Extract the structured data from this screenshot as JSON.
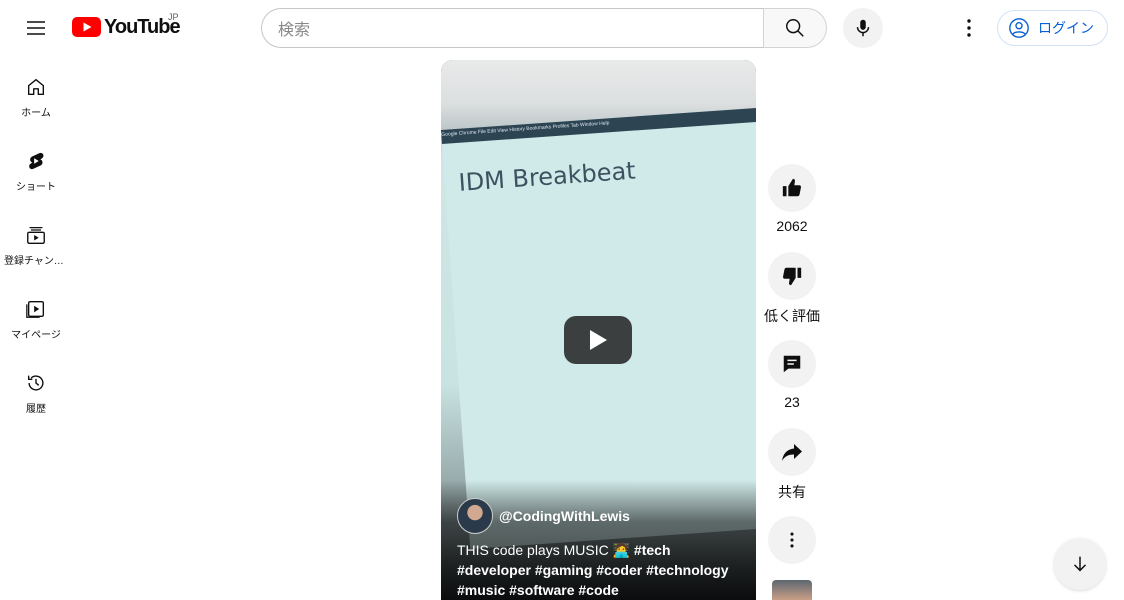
{
  "header": {
    "logo_text": "YouTube",
    "region": "JP",
    "search_placeholder": "検索",
    "login_label": "ログイン"
  },
  "sidebar": {
    "items": [
      {
        "label": "ホーム",
        "icon": "home-icon"
      },
      {
        "label": "ショート",
        "icon": "shorts-icon"
      },
      {
        "label": "登録チャンネル",
        "icon": "subscriptions-icon"
      },
      {
        "label": "マイページ",
        "icon": "library-icon"
      },
      {
        "label": "履歴",
        "icon": "history-icon"
      }
    ]
  },
  "video": {
    "screen_tabs": "Google Chrome   File   Edit   View   History   Bookmarks   Profiles   Tab   Window   Help",
    "code_heading": "IDM Breakbeat",
    "channel": "@CodingWithLewis",
    "title_plain": "THIS code plays MUSIC 🧑‍💻",
    "hashtags": "#tech #developer #gaming #coder #technology #music #software #code"
  },
  "actions": {
    "like_count": "2062",
    "dislike_label": "低く評価",
    "comment_count": "23",
    "share_label": "共有"
  },
  "colors": {
    "brand_red": "#ff0000",
    "link_blue": "#065fd4"
  }
}
